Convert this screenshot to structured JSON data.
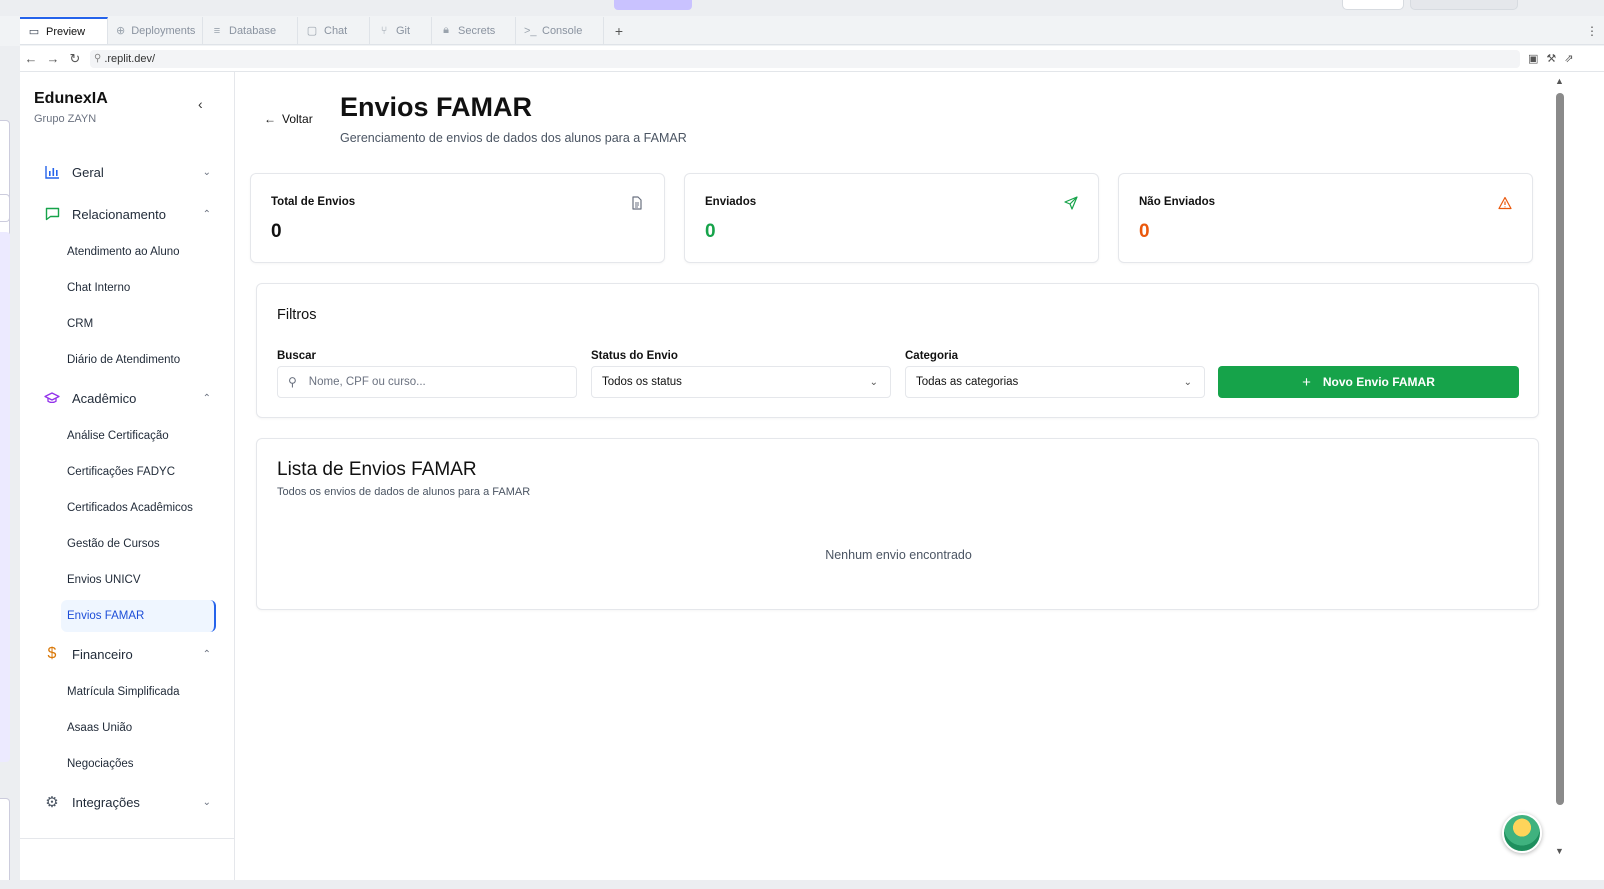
{
  "ide": {
    "status_label": "",
    "tabs": [
      {
        "label": "Preview",
        "icon": "monitor-icon",
        "active": true
      },
      {
        "label": "Deployments",
        "icon": "deploy-icon"
      },
      {
        "label": "Database",
        "icon": "database-icon"
      },
      {
        "label": "Chat",
        "icon": "chat-icon"
      },
      {
        "label": "Git",
        "icon": "git-icon"
      },
      {
        "label": "Secrets",
        "icon": "lock-icon"
      },
      {
        "label": "Console",
        "icon": "terminal-icon"
      }
    ],
    "add_tab": "+",
    "more": "⋮",
    "url": ".replit.dev/"
  },
  "sidebar": {
    "brand_title": "EdunexIA",
    "brand_subtitle": "Grupo ZAYN",
    "groups": [
      {
        "label": "Geral",
        "icon": "chart-bar-icon",
        "expanded": false,
        "items": []
      },
      {
        "label": "Relacionamento",
        "icon": "message-square-icon",
        "expanded": true,
        "items": [
          "Atendimento ao Aluno",
          "Chat Interno",
          "CRM",
          "Diário de Atendimento"
        ]
      },
      {
        "label": "Acadêmico",
        "icon": "graduation-cap-icon",
        "expanded": true,
        "items": [
          "Análise Certificação",
          "Certificações FADYC",
          "Certificados Acadêmicos",
          "Gestão de Cursos",
          "Envios UNICV",
          "Envios FAMAR"
        ]
      },
      {
        "label": "Financeiro",
        "icon": "dollar-icon",
        "expanded": true,
        "items": [
          "Matrícula Simplificada",
          "Asaas União",
          "Negociações"
        ]
      },
      {
        "label": "Integrações",
        "icon": "gear-icon",
        "expanded": false,
        "items": []
      }
    ],
    "active_item": "Envios FAMAR"
  },
  "page": {
    "back_label": "Voltar",
    "title": "Envios FAMAR",
    "subtitle": "Gerenciamento de envios de dados dos alunos para a FAMAR"
  },
  "stats": [
    {
      "label": "Total de Envios",
      "value": "0",
      "color": "#111111",
      "icon": "file-text-icon"
    },
    {
      "label": "Enviados",
      "value": "0",
      "color": "#16a34a",
      "icon": "send-icon"
    },
    {
      "label": "Não Enviados",
      "value": "0",
      "color": "#ea580c",
      "icon": "alert-triangle-icon"
    }
  ],
  "filters": {
    "title": "Filtros",
    "search_label": "Buscar",
    "search_placeholder": "Nome, CPF ou curso...",
    "status_label": "Status do Envio",
    "status_value": "Todos os status",
    "category_label": "Categoria",
    "category_value": "Todas as categorias",
    "new_button": "Novo Envio FAMAR"
  },
  "list": {
    "title": "Lista de Envios FAMAR",
    "subtitle": "Todos os envios de dados de alunos para a FAMAR",
    "empty": "Nenhum envio encontrado"
  },
  "colors": {
    "accent": "#2563eb",
    "primary_green": "#16a34a",
    "warning_orange": "#ea580c"
  }
}
